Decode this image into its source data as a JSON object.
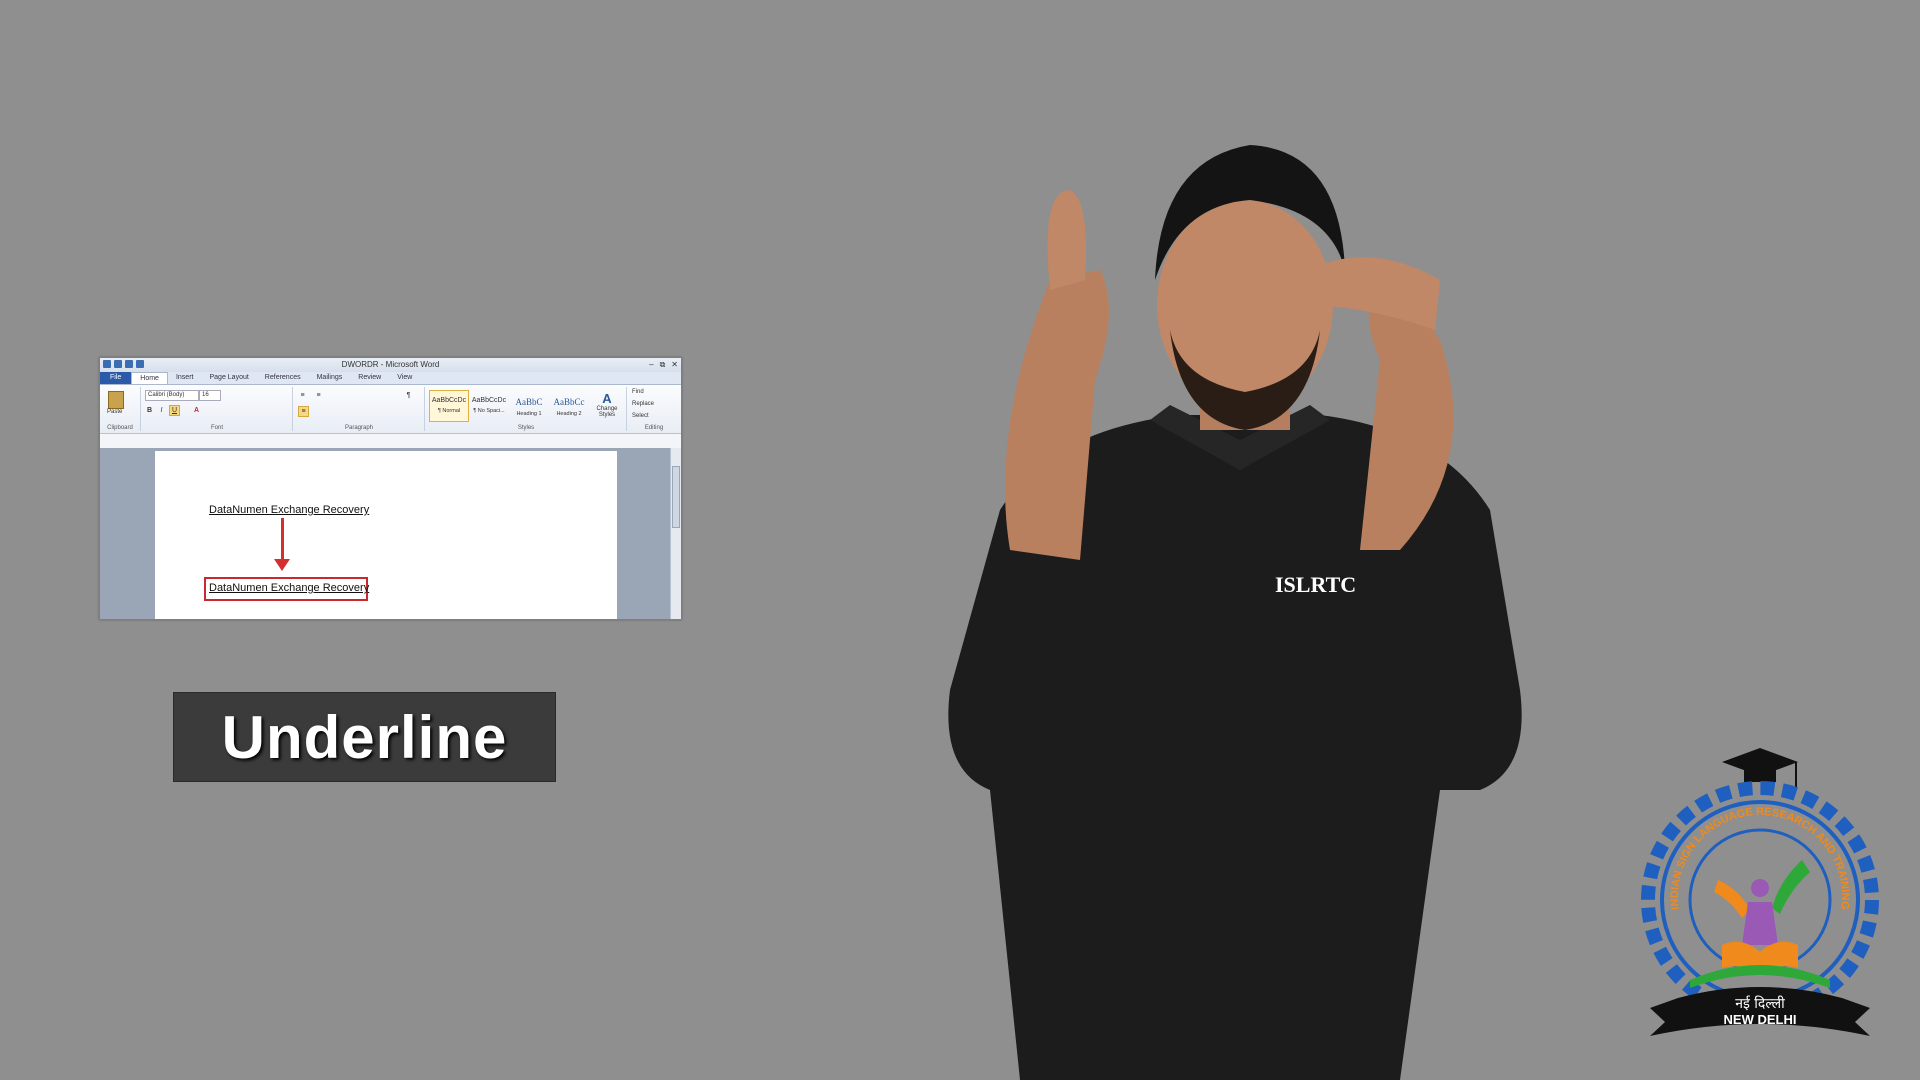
{
  "word": {
    "window_title": "DWORDR - Microsoft Word",
    "tabs": [
      "File",
      "Home",
      "Insert",
      "Page Layout",
      "References",
      "Mailings",
      "Review",
      "View"
    ],
    "font_name": "Calibri (Body)",
    "font_size": "16",
    "groups": {
      "clipboard": "Clipboard",
      "font": "Font",
      "paragraph": "Paragraph",
      "styles": "Styles",
      "editing": "Editing"
    },
    "paste_label": "Paste",
    "styles": [
      {
        "preview": "AaBbCcDc",
        "name": "¶ Normal"
      },
      {
        "preview": "AaBbCcDc",
        "name": "¶ No Spaci..."
      },
      {
        "preview": "AaBbC",
        "name": "Heading 1"
      },
      {
        "preview": "AaBbCc",
        "name": "Heading 2"
      }
    ],
    "change_styles": "Change Styles",
    "editing": {
      "find": "Find",
      "replace": "Replace",
      "select": "Select"
    },
    "doc_text_1": "DataNumen Exchange Recovery",
    "doc_text_2": "DataNumen Exchange Recovery"
  },
  "caption": "Underline",
  "shirt_text": "ISLRTC",
  "logo": {
    "arc_text": "INDIAN SIGN LANGUAGE RESEARCH AND TRAINING CENTRE",
    "hindi_text": "नई दिल्ली",
    "city_text": "NEW DELHI"
  },
  "colors": {
    "background": "#8f8f8f",
    "highlight_red": "#c8282e",
    "caption_bg": "#3b3b3b",
    "logo_blue": "#1f5fbf",
    "logo_orange": "#f08a1c",
    "logo_green": "#2fa83a"
  }
}
